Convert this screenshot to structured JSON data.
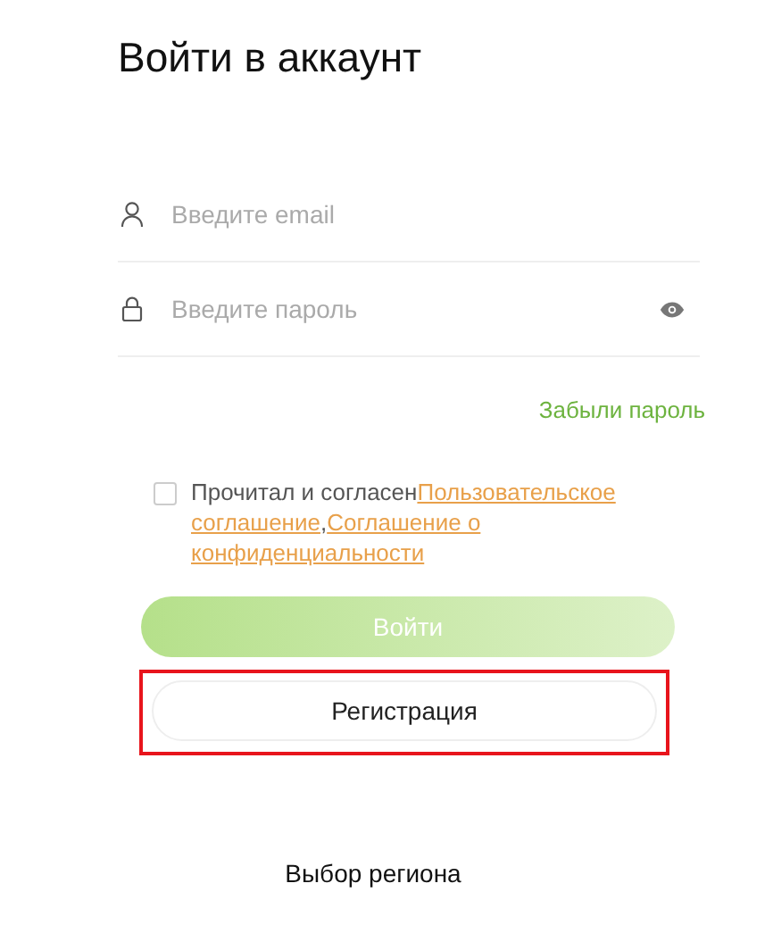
{
  "title": "Войти в аккаунт",
  "fields": [
    {
      "kind": "email",
      "placeholder": "Введите email"
    },
    {
      "kind": "password",
      "placeholder": "Введите пароль"
    }
  ],
  "forgot_link": "Забыли пароль",
  "agreement": {
    "checked": false,
    "text": "Прочитал и согласен",
    "links": [
      "Пользовательское соглашение",
      "Соглашение о конфиденциальности"
    ],
    "separator": ","
  },
  "login_button": {
    "label": "Войти",
    "disabled": true
  },
  "register_button": {
    "label": "Регистрация",
    "highlighted": true
  },
  "region_link": "Выбор региона"
}
